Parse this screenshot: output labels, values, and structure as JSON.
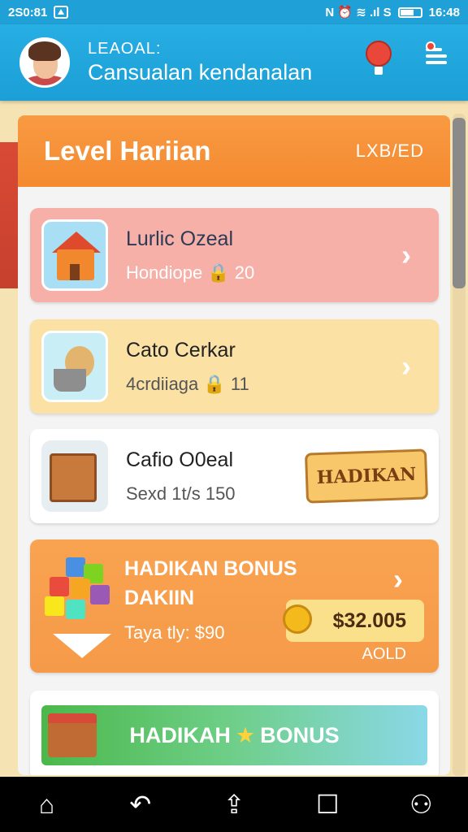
{
  "status_bar": {
    "left_text": "2S0:81",
    "right_text": "N  ⏰  ≋  .ıl S",
    "time": "16:48"
  },
  "header": {
    "small": "LEAOAL:",
    "big": "Cansualan kendanalan"
  },
  "panel": {
    "title": "Level Hariian",
    "right_label": "LXB/ED"
  },
  "cards": [
    {
      "title": "Lurlic Ozeal",
      "subtitle": "Hondiope 🔒 20"
    },
    {
      "title": "Cato Cerkar",
      "subtitle": "4crdiiaga 🔒 11"
    },
    {
      "title": "Cafio O0eal",
      "subtitle": "Sexd 1t/s 150",
      "ribbon": "HADIKAN"
    }
  ],
  "bonus": {
    "title_line1": "HADIKAN BONUS",
    "title_line2": "DAKIIN",
    "subtitle": "Taya tly: $90",
    "price": "$32.005",
    "add_label": "AOLD"
  },
  "banner": {
    "left": "HADIKAH",
    "right": "BONUS"
  },
  "colors": {
    "header_blue": "#1b9fd6",
    "panel_orange": "#f58a30",
    "card_pink": "#f7b0a8",
    "card_yellow": "#fbe2a4"
  }
}
